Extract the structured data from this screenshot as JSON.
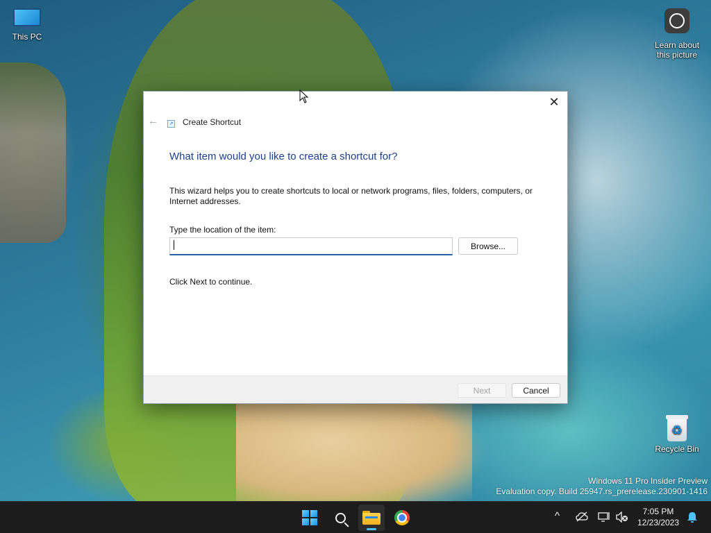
{
  "desktop": {
    "icons": [
      {
        "label": "This PC",
        "icon": "computer-icon"
      },
      {
        "label": "Learn about this picture",
        "icon": "learn-about-picture-icon"
      },
      {
        "label": "Recycle Bin",
        "icon": "recycle-bin-icon"
      }
    ],
    "watermark": {
      "line1": "Windows 11 Pro Insider Preview",
      "line2": "Evaluation copy. Build 25947.rs_prerelease.230901-1416"
    }
  },
  "dialog": {
    "title": "Create Shortcut",
    "title_icon": "shortcut-icon",
    "heading": "What item would you like to create a shortcut for?",
    "description": "This wizard helps you to create shortcuts to local or network programs, files, folders, computers, or Internet addresses.",
    "location_label": "Type the location of the item:",
    "location_value": "",
    "browse_label": "Browse...",
    "hint": "Click Next to continue.",
    "next_label": "Next",
    "cancel_label": "Cancel",
    "close_symbol": "✕",
    "back_symbol": "←"
  },
  "taskbar": {
    "apps": [
      {
        "name": "Start",
        "icon": "windows-start-icon"
      },
      {
        "name": "Search",
        "icon": "search-icon"
      },
      {
        "name": "File Explorer",
        "icon": "file-explorer-icon",
        "active": true
      },
      {
        "name": "Google Chrome",
        "icon": "chrome-icon"
      }
    ],
    "tray": {
      "chevron": "^",
      "time": "7:05 PM",
      "date": "12/23/2023"
    }
  },
  "colors": {
    "heading_blue": "#1d3f8a",
    "input_accent": "#245fa8",
    "taskbar_bg": "#1c1c1c",
    "indicator": "#4cc2ff"
  }
}
